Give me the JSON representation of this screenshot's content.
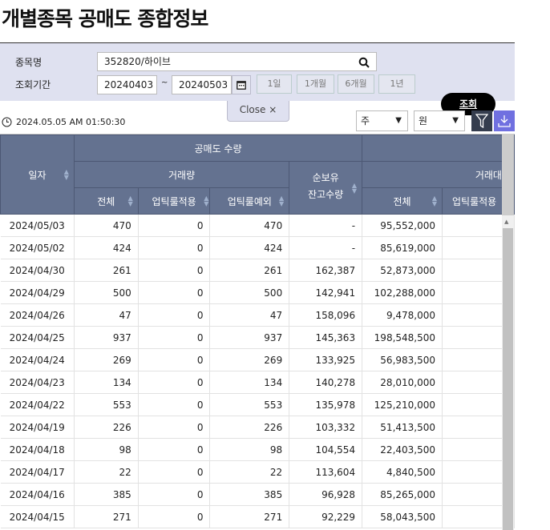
{
  "title": "개별종목 공매도 종합정보",
  "search": {
    "stock_label": "종목명",
    "stock_value": "352820/하이브",
    "period_label": "조회기간",
    "from": "20240403",
    "sep": "~",
    "to": "20240503",
    "periods": [
      "1일",
      "1개월",
      "6개월",
      "1년"
    ],
    "query": "조회",
    "close": "Close ×"
  },
  "timestamp": "2024.05.05 AM 01:50:30",
  "unit_select": "주",
  "currency_select": "원",
  "headers": {
    "date": "일자",
    "short_qty": "공매도 수량",
    "volume": "거래량",
    "total": "전체",
    "uptick": "업틱룰적용",
    "uptick_ex": "업틱룰예외",
    "net_hold": "순보유",
    "net_hold2": "잔고수량",
    "amount": "거래대금",
    "amt_total": "전체",
    "amt_uptick": "업틱룰적용"
  },
  "rows": [
    [
      "2024/05/03",
      "470",
      "0",
      "470",
      "-",
      "95,552,000"
    ],
    [
      "2024/05/02",
      "424",
      "0",
      "424",
      "-",
      "85,619,000"
    ],
    [
      "2024/04/30",
      "261",
      "0",
      "261",
      "162,387",
      "52,873,000"
    ],
    [
      "2024/04/29",
      "500",
      "0",
      "500",
      "142,941",
      "102,288,000"
    ],
    [
      "2024/04/26",
      "47",
      "0",
      "47",
      "158,096",
      "9,478,000"
    ],
    [
      "2024/04/25",
      "937",
      "0",
      "937",
      "145,363",
      "198,548,500"
    ],
    [
      "2024/04/24",
      "269",
      "0",
      "269",
      "133,925",
      "56,983,500"
    ],
    [
      "2024/04/23",
      "134",
      "0",
      "134",
      "140,278",
      "28,010,000"
    ],
    [
      "2024/04/22",
      "553",
      "0",
      "553",
      "135,978",
      "125,210,000"
    ],
    [
      "2024/04/19",
      "226",
      "0",
      "226",
      "103,332",
      "51,413,500"
    ],
    [
      "2024/04/18",
      "98",
      "0",
      "98",
      "104,554",
      "22,403,500"
    ],
    [
      "2024/04/17",
      "22",
      "0",
      "22",
      "113,604",
      "4,840,500"
    ],
    [
      "2024/04/16",
      "385",
      "0",
      "385",
      "96,928",
      "85,265,000"
    ],
    [
      "2024/04/15",
      "271",
      "0",
      "271",
      "92,229",
      "58,043,500"
    ]
  ]
}
